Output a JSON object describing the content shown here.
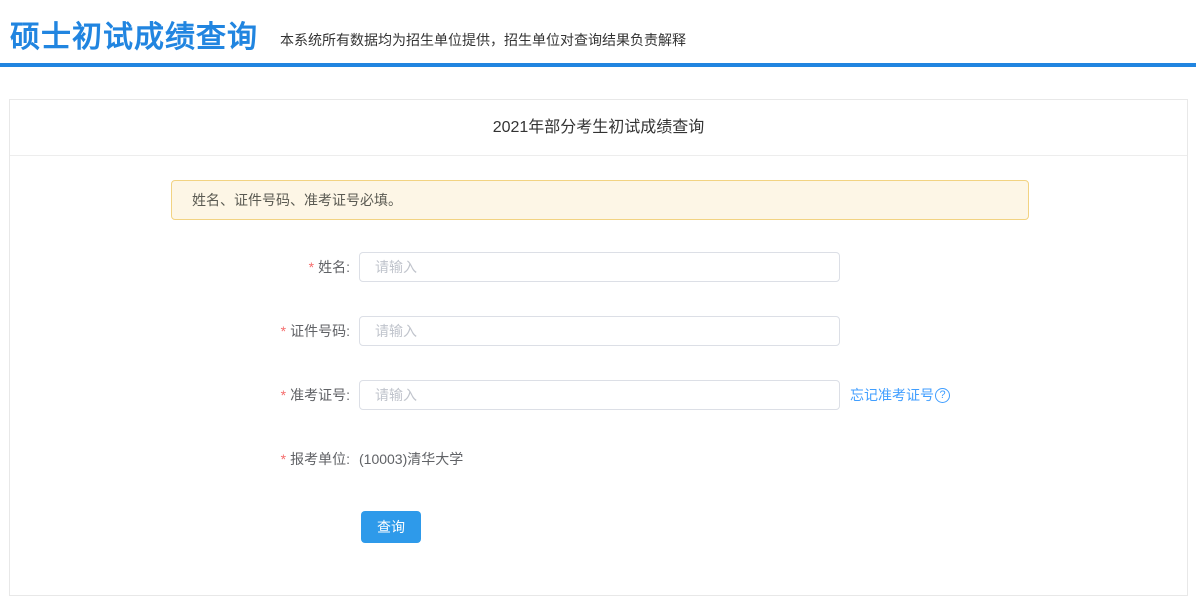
{
  "header": {
    "title": "硕士初试成绩查询",
    "subtitle": "本系统所有数据均为招生单位提供，招生单位对查询结果负责解释"
  },
  "card": {
    "title": "2021年部分考生初试成绩查询",
    "alert_text": "姓名、证件号码、准考证号必填。"
  },
  "form": {
    "required_mark": "*",
    "fields": [
      {
        "label": "姓名:",
        "placeholder": "请输入"
      },
      {
        "label": "证件号码:",
        "placeholder": "请输入"
      },
      {
        "label": "准考证号:",
        "placeholder": "请输入",
        "link_text": "忘记准考证号"
      },
      {
        "label": "报考单位:",
        "value": "(10003)清华大学"
      }
    ],
    "submit_label": "查询"
  },
  "icons": {
    "question_circle": "?"
  },
  "colors": {
    "brand_blue": "#2185e0",
    "link_blue": "#409eff",
    "button_blue": "#2e9aea",
    "alert_bg": "#fdf6e6",
    "alert_border": "#f2d382",
    "required_red": "#f56c6c",
    "input_border": "#dcdfe6",
    "placeholder_gray": "#c0c4cc"
  }
}
